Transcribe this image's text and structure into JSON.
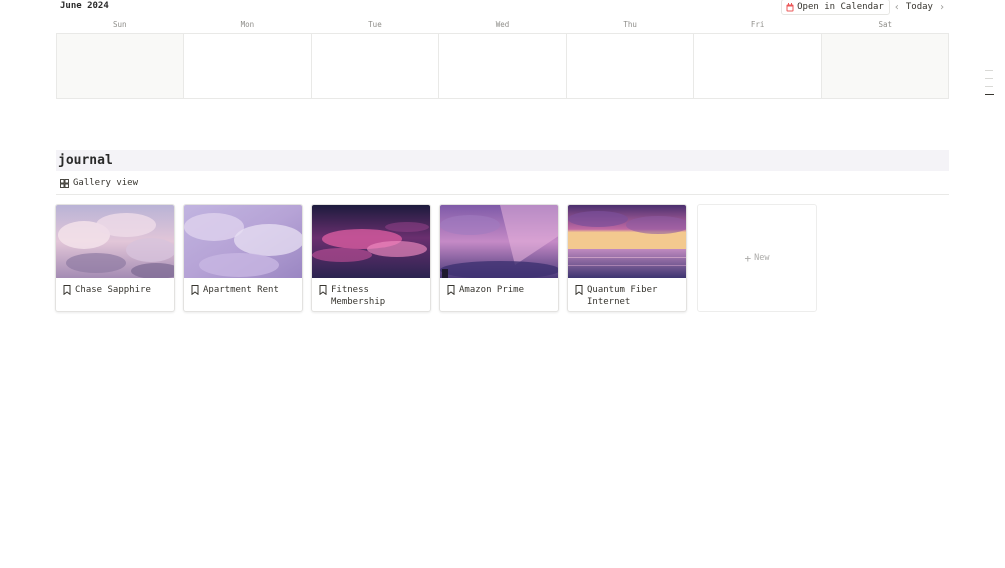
{
  "calendar": {
    "month_label": "June 2024",
    "open_button_label": "Open in Calendar",
    "today_label": "Today",
    "prev_icon": "chevron-left-icon",
    "next_icon": "chevron-right-icon",
    "weekdays": [
      "Sun",
      "Mon",
      "Tue",
      "Wed",
      "Thu",
      "Fri",
      "Sat"
    ]
  },
  "database": {
    "title": "journal",
    "view_label": "Gallery view",
    "new_label": "New",
    "cards": [
      {
        "title": "Chase Sapphire",
        "cover": "pink-lavender-clouds"
      },
      {
        "title": "Apartment Rent",
        "cover": "lilac-soft-clouds"
      },
      {
        "title": "Fitness Membership",
        "cover": "dusk-magenta-clouds"
      },
      {
        "title": "Amazon Prime",
        "cover": "purple-sky-beam"
      },
      {
        "title": "Quantum Fiber Internet",
        "cover": "purple-sunset-sea"
      }
    ]
  },
  "colors": {
    "accent_red": "#eb5757",
    "title_bar_bg": "#f4f3f7",
    "weekend_bg": "#f9f9f7"
  }
}
